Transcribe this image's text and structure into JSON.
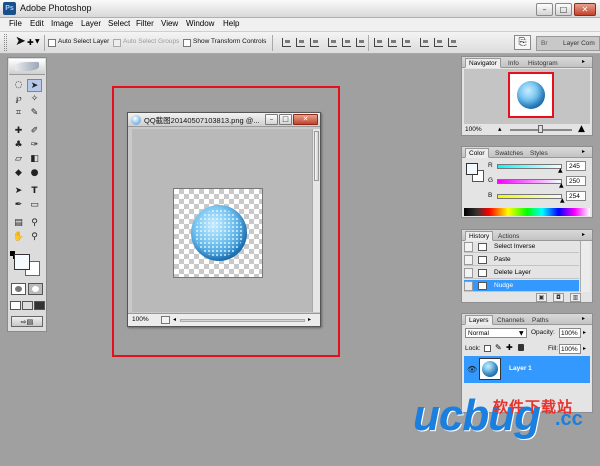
{
  "app": {
    "title": "Adobe Photoshop",
    "icon_name": "photoshop-icon"
  },
  "window_controls": {
    "minimize": "–",
    "maximize": "□",
    "close": "✕"
  },
  "menu": [
    "File",
    "Edit",
    "Image",
    "Layer",
    "Select",
    "Filter",
    "View",
    "Window",
    "Help"
  ],
  "options_bar": {
    "auto_select_layer": "Auto Select Layer",
    "auto_select_groups": "Auto Select Groups",
    "show_transform_controls": "Show Transform Controls",
    "right_tab_brushes": "Br",
    "right_tab_layer_comps": "Layer Com"
  },
  "document": {
    "title": "QQ截图20140507103813.png @...",
    "zoom": "100%",
    "controls": {
      "minimize": "–",
      "maximize": "□",
      "close": "✕"
    }
  },
  "navigator_panel": {
    "tabs": [
      "Navigator",
      "Info",
      "Histogram"
    ],
    "zoom": "100%"
  },
  "color_panel": {
    "tabs": [
      "Color",
      "Swatches",
      "Styles"
    ],
    "channels": [
      {
        "label": "R",
        "value": "245"
      },
      {
        "label": "G",
        "value": "250"
      },
      {
        "label": "B",
        "value": "254"
      }
    ]
  },
  "history_panel": {
    "tabs": [
      "History",
      "Actions"
    ],
    "items": [
      "Select Inverse",
      "Paste",
      "Delete Layer",
      "Nudge"
    ],
    "selected_index": 3
  },
  "layers_panel": {
    "tabs": [
      "Layers",
      "Channels",
      "Paths"
    ],
    "blend_mode": "Normal",
    "opacity_label": "Opacity:",
    "opacity": "100%",
    "lock_label": "Lock:",
    "fill_label": "Fill:",
    "fill": "100%",
    "layer_name": "Layer 1"
  },
  "watermark": {
    "logo": "ucbug",
    "tld": ".cc",
    "cn_text": "软件下载站"
  },
  "colors": {
    "accent_blue": "#3399ff",
    "highlight_red": "#e5101b",
    "watermark_blue": "#1b7fe0"
  }
}
